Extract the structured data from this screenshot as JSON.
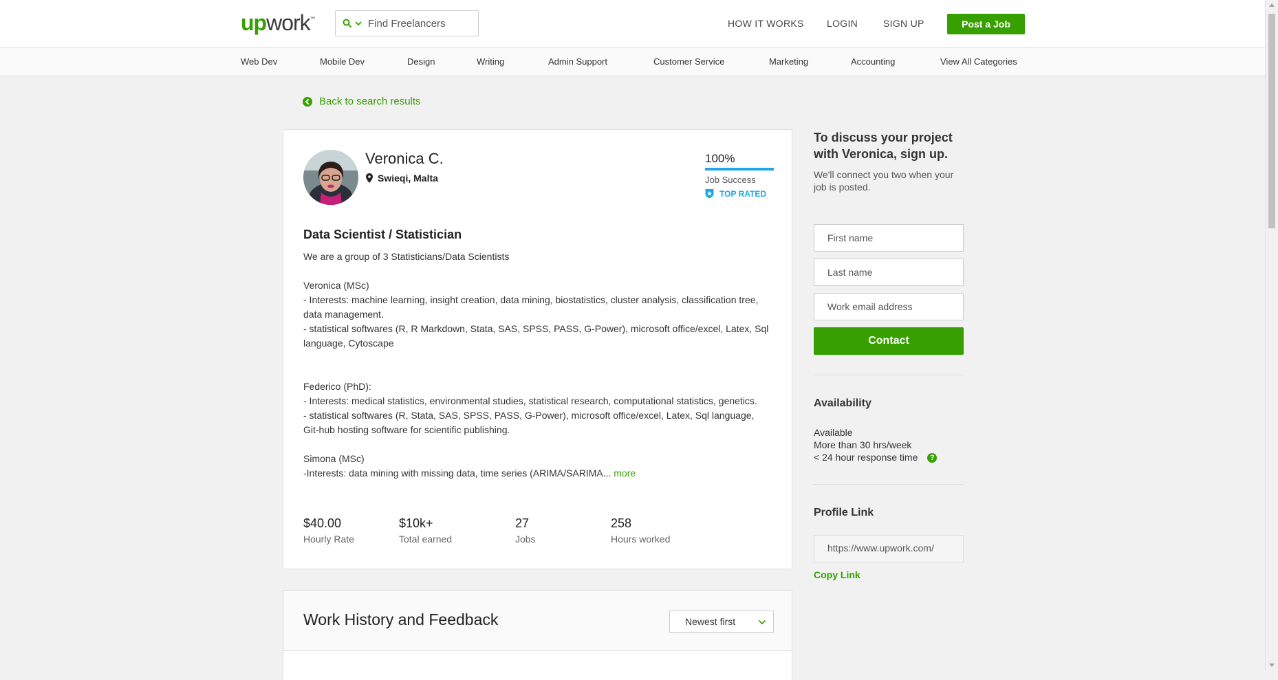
{
  "header": {
    "logo_brand": "up",
    "logo_rest": "work",
    "logo_tm": "™",
    "search_placeholder": "Find Freelancers",
    "nav": {
      "how_it_works": "HOW IT WORKS",
      "login": "LOGIN",
      "sign_up": "SIGN UP"
    },
    "post_job": "Post a Job"
  },
  "categories": [
    "Web Dev",
    "Mobile Dev",
    "Design",
    "Writing",
    "Admin Support",
    "Customer Service",
    "Marketing",
    "Accounting",
    "View All Categories"
  ],
  "back_link": "Back to search results",
  "profile": {
    "name": "Veronica C.",
    "location": "Swieqi, Malta",
    "job_success_pct": "100%",
    "job_success_label": "Job Success",
    "badge": "TOP RATED",
    "title": "Data Scientist / Statistician",
    "description": "We are a group of 3 Statisticians/Data Scientists\n\nVeronica (MSc)\n- Interests: machine learning, insight creation, data mining, biostatistics, cluster analysis, classification tree, data management.\n- statistical softwares (R, R Markdown, Stata, SAS, SPSS, PASS, G-Power), microsoft office/excel, Latex, Sql language, Cytoscape\n\n\nFederico (PhD):\n- Interests: medical statistics, environmental studies, statistical research, computational statistics, genetics.\n- statistical softwares (R, Stata, SAS, SPSS, PASS, G-Power), microsoft office/excel, Latex, Sql language, Git-hub hosting software for scientific publishing.\n\nSimona (MSc)\n-Interests: data mining with missing data, time series (ARIMA/SARIMA...",
    "more": "more",
    "stats": {
      "rate_value": "$40.00",
      "rate_label": "Hourly Rate",
      "earned_value": "$10k+",
      "earned_label": "Total earned",
      "jobs_value": "27",
      "jobs_label": "Jobs",
      "hours_value": "258",
      "hours_label": "Hours worked"
    }
  },
  "work_history": {
    "title": "Work History and Feedback",
    "sort_selected": "Newest first"
  },
  "sidebar": {
    "heading": "To discuss your project with Veronica, sign up.",
    "subtext": "We'll connect you two when your job is posted.",
    "first_name_placeholder": "First name",
    "last_name_placeholder": "Last name",
    "email_placeholder": "Work email address",
    "contact": "Contact",
    "availability_title": "Availability",
    "availability_status": "Available",
    "availability_hours": "More than 30 hrs/week",
    "availability_response": "< 24 hour response time",
    "help_glyph": "?",
    "profile_link_title": "Profile Link",
    "profile_link_value": "https://www.upwork.com/",
    "copy_link": "Copy Link"
  },
  "colors": {
    "brand_green": "#37a000",
    "accent_blue": "#1ea7e1"
  }
}
